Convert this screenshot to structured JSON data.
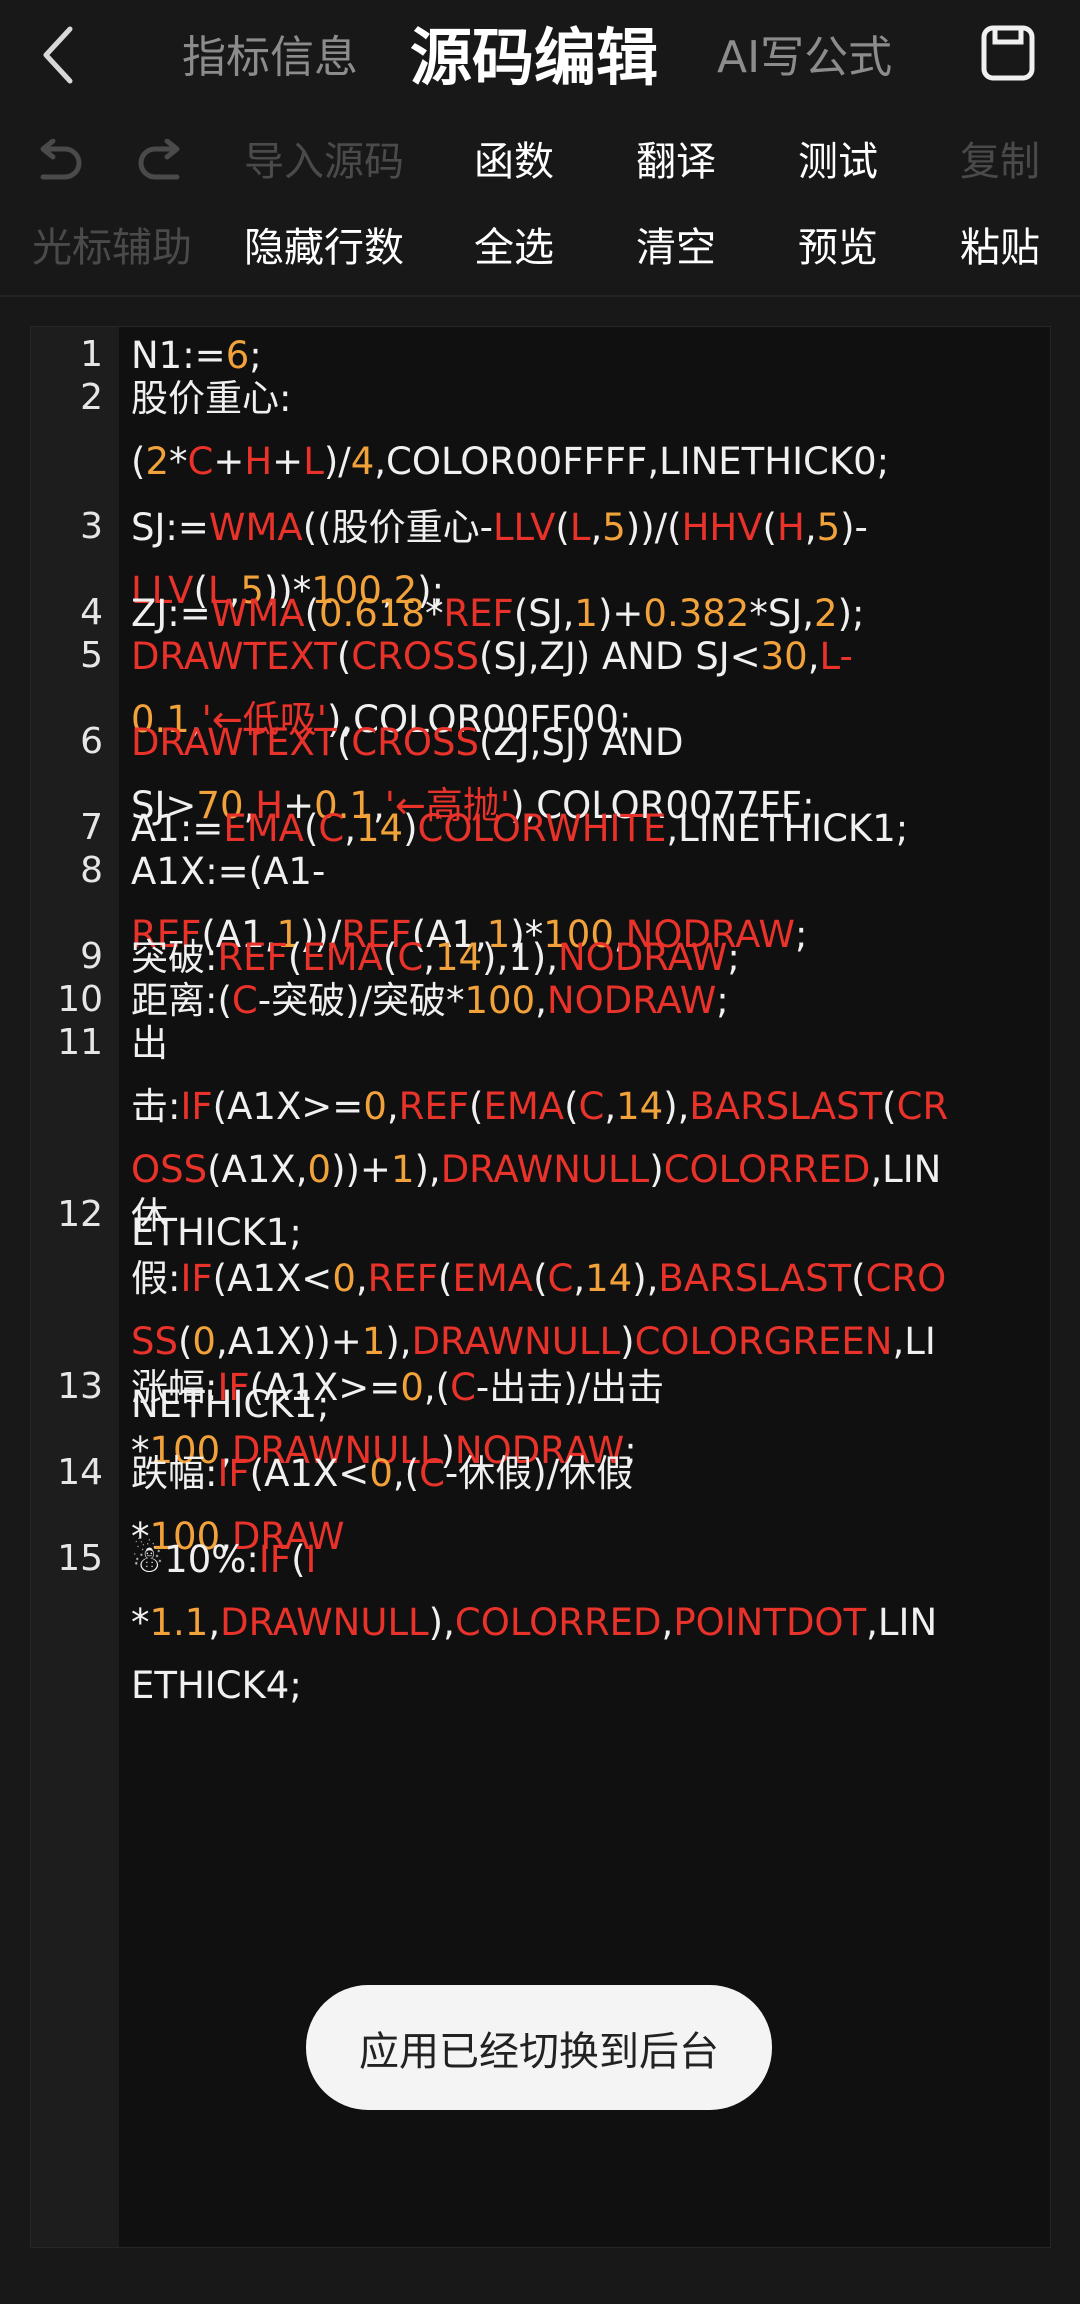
{
  "header": {
    "back_icon": "chevron-left-icon",
    "tab_info": "指标信息",
    "tab_edit": "源码编辑",
    "tab_ai": "AI写公式",
    "save_icon": "save-icon"
  },
  "toolbar": {
    "undo_icon": "undo-icon",
    "redo_icon": "redo-icon",
    "import": "导入源码",
    "functions": "函数",
    "translate": "翻译",
    "test": "测试",
    "copy": "复制",
    "cursor_assist": "光标辅助",
    "hide_line_numbers": "隐藏行数",
    "select_all": "全选",
    "clear": "清空",
    "preview": "预览",
    "paste": "粘贴"
  },
  "colors": {
    "background": "#181818",
    "editor_bg": "#101010",
    "gutter_bg": "#1d1d1d",
    "keyword_red": "#e8322a",
    "number_orange": "#f1a23a",
    "plain_text": "#f0f0f0",
    "disabled": "#4a4a4a"
  },
  "code_lines": [
    {
      "num": "1",
      "rows": [
        [
          [
            "N1:=",
            ""
          ],
          [
            "6",
            "o"
          ],
          [
            ";",
            ""
          ]
        ]
      ]
    },
    {
      "num": "2",
      "rows": [
        [
          [
            "股价重心:",
            ""
          ]
        ],
        [
          [
            "(",
            ""
          ],
          [
            "2",
            "o"
          ],
          [
            "*",
            ""
          ],
          [
            "C",
            "r"
          ],
          [
            "+",
            ""
          ],
          [
            "H",
            "r"
          ],
          [
            "+",
            ""
          ],
          [
            "L",
            "r"
          ],
          [
            ")/",
            ""
          ],
          [
            "4",
            "o"
          ],
          [
            ",COLOR00FFFF,LINETHICK0;",
            ""
          ]
        ]
      ]
    },
    {
      "num": "3",
      "rows": [
        [
          [
            "SJ:=",
            ""
          ],
          [
            "WMA",
            "r"
          ],
          [
            "((股价重心-",
            ""
          ],
          [
            "LLV",
            "r"
          ],
          [
            "(",
            ""
          ],
          [
            "L",
            "r"
          ],
          [
            ",",
            ""
          ],
          [
            "5",
            "o"
          ],
          [
            "))/(",
            ""
          ],
          [
            "HHV",
            "r"
          ],
          [
            "(",
            ""
          ],
          [
            "H",
            "r"
          ],
          [
            ",",
            ""
          ],
          [
            "5",
            "o"
          ],
          [
            ")-",
            ""
          ]
        ],
        [
          [
            "LLV",
            "r"
          ],
          [
            "(",
            ""
          ],
          [
            "L",
            "r"
          ],
          [
            ",",
            ""
          ],
          [
            "5",
            "o"
          ],
          [
            "))*",
            ""
          ],
          [
            "100",
            "o"
          ],
          [
            ",",
            ""
          ],
          [
            "2",
            "o"
          ],
          [
            ");",
            ""
          ]
        ]
      ]
    },
    {
      "num": "4",
      "rows": [
        [
          [
            "ZJ:=",
            ""
          ],
          [
            "WMA",
            "r"
          ],
          [
            "(",
            ""
          ],
          [
            "0.618",
            "o"
          ],
          [
            "*",
            ""
          ],
          [
            "REF",
            "r"
          ],
          [
            "(SJ,",
            ""
          ],
          [
            "1",
            "o"
          ],
          [
            ")+",
            ""
          ],
          [
            "0.382",
            "o"
          ],
          [
            "*SJ,",
            ""
          ],
          [
            "2",
            "o"
          ],
          [
            ");",
            ""
          ]
        ]
      ]
    },
    {
      "num": "5",
      "rows": [
        [
          [
            "DRAWTEXT",
            "r"
          ],
          [
            "(",
            ""
          ],
          [
            "CROSS",
            "r"
          ],
          [
            "(SJ,ZJ) AND SJ<",
            ""
          ],
          [
            "30",
            "o"
          ],
          [
            ",",
            ""
          ],
          [
            "L-",
            "r"
          ]
        ],
        [
          [
            "0.1",
            "o"
          ],
          [
            ",",
            ""
          ],
          [
            "'←低吸'",
            "r"
          ],
          [
            "),COLOR00FF00;",
            ""
          ]
        ]
      ]
    },
    {
      "num": "6",
      "rows": [
        [
          [
            "DRAWTEXT",
            "r"
          ],
          [
            "(",
            ""
          ],
          [
            "CROSS",
            "r"
          ],
          [
            "(ZJ,SJ) AND",
            ""
          ]
        ],
        [
          [
            "SJ>",
            ""
          ],
          [
            "70",
            "o"
          ],
          [
            ",",
            ""
          ],
          [
            "H",
            "r"
          ],
          [
            "+",
            ""
          ],
          [
            "0.1",
            "o"
          ],
          [
            ",",
            ""
          ],
          [
            "'←高抛'",
            "r"
          ],
          [
            "),COLOR0077FF;",
            ""
          ]
        ]
      ]
    },
    {
      "num": "7",
      "rows": [
        [
          [
            "A1:=",
            ""
          ],
          [
            "EMA",
            "r"
          ],
          [
            "(",
            ""
          ],
          [
            "C",
            "r"
          ],
          [
            ",",
            ""
          ],
          [
            "14",
            "o"
          ],
          [
            ")",
            ""
          ],
          [
            "COLORWHITE",
            "r"
          ],
          [
            ",LINETHICK1;",
            ""
          ]
        ]
      ]
    },
    {
      "num": "8",
      "rows": [
        [
          [
            "A1X:=(A1-",
            ""
          ]
        ],
        [
          [
            "REF",
            "r"
          ],
          [
            "(A1,",
            ""
          ],
          [
            "1",
            "o"
          ],
          [
            "))/",
            ""
          ],
          [
            "REF",
            "r"
          ],
          [
            "(A1,",
            ""
          ],
          [
            "1",
            "o"
          ],
          [
            ")*",
            ""
          ],
          [
            "100",
            "o"
          ],
          [
            ",",
            ""
          ],
          [
            "NODRAW",
            "r"
          ],
          [
            ";",
            ""
          ]
        ]
      ]
    },
    {
      "num": "9",
      "rows": [
        [
          [
            "突破:",
            ""
          ],
          [
            "REF",
            "r"
          ],
          [
            "(",
            ""
          ],
          [
            "EMA",
            "r"
          ],
          [
            "(",
            ""
          ],
          [
            "C",
            "r"
          ],
          [
            ",",
            ""
          ],
          [
            "14",
            "o"
          ],
          [
            "),1),",
            ""
          ],
          [
            "NODRAW",
            "r"
          ],
          [
            ";",
            ""
          ]
        ]
      ]
    },
    {
      "num": "10",
      "rows": [
        [
          [
            "距离:(",
            ""
          ],
          [
            "C",
            "r"
          ],
          [
            "-突破)/突破*",
            ""
          ],
          [
            "100",
            "o"
          ],
          [
            ",",
            ""
          ],
          [
            "NODRAW",
            "r"
          ],
          [
            ";",
            ""
          ]
        ]
      ]
    },
    {
      "num": "11",
      "rows": [
        [
          [
            "出",
            ""
          ]
        ],
        [
          [
            "击:",
            ""
          ],
          [
            "IF",
            "r"
          ],
          [
            "(A1X>=",
            ""
          ],
          [
            "0",
            "o"
          ],
          [
            ",",
            ""
          ],
          [
            "REF",
            "r"
          ],
          [
            "(",
            ""
          ],
          [
            "EMA",
            "r"
          ],
          [
            "(",
            ""
          ],
          [
            "C",
            "r"
          ],
          [
            ",",
            ""
          ],
          [
            "14",
            "o"
          ],
          [
            "),",
            ""
          ],
          [
            "BARSLAST",
            "r"
          ],
          [
            "(",
            ""
          ],
          [
            "CR",
            "r"
          ]
        ],
        [
          [
            "OSS",
            "r"
          ],
          [
            "(A1X,",
            ""
          ],
          [
            "0",
            "o"
          ],
          [
            "))+",
            ""
          ],
          [
            "1",
            "o"
          ],
          [
            "),",
            ""
          ],
          [
            "DRAWNULL",
            "r"
          ],
          [
            ")",
            ""
          ],
          [
            "COLORRED",
            "r"
          ],
          [
            ",LIN",
            ""
          ]
        ],
        [
          [
            "ETHICK1;",
            ""
          ]
        ]
      ]
    },
    {
      "num": "12",
      "rows": [
        [
          [
            "休",
            ""
          ]
        ],
        [
          [
            "假:",
            ""
          ],
          [
            "IF",
            "r"
          ],
          [
            "(A1X<",
            ""
          ],
          [
            "0",
            "o"
          ],
          [
            ",",
            ""
          ],
          [
            "REF",
            "r"
          ],
          [
            "(",
            ""
          ],
          [
            "EMA",
            "r"
          ],
          [
            "(",
            ""
          ],
          [
            "C",
            "r"
          ],
          [
            ",",
            ""
          ],
          [
            "14",
            "o"
          ],
          [
            "),",
            ""
          ],
          [
            "BARSLAST",
            "r"
          ],
          [
            "(",
            ""
          ],
          [
            "CRO",
            "r"
          ]
        ],
        [
          [
            "SS",
            "r"
          ],
          [
            "(",
            ""
          ],
          [
            "0",
            "o"
          ],
          [
            ",A1X))+",
            ""
          ],
          [
            "1",
            "o"
          ],
          [
            "),",
            ""
          ],
          [
            "DRAWNULL",
            "r"
          ],
          [
            ")",
            ""
          ],
          [
            "COLORGREEN",
            "r"
          ],
          [
            ",LI",
            ""
          ]
        ],
        [
          [
            "NETHICK1;",
            ""
          ]
        ]
      ]
    },
    {
      "num": "13",
      "rows": [
        [
          [
            "涨幅:",
            ""
          ],
          [
            "IF",
            "r"
          ],
          [
            "(A1X>=",
            ""
          ],
          [
            "0",
            "o"
          ],
          [
            ",(",
            ""
          ],
          [
            "C",
            "r"
          ],
          [
            "-出击)/出击",
            ""
          ]
        ],
        [
          [
            "*",
            ""
          ],
          [
            "100",
            "o"
          ],
          [
            ",",
            ""
          ],
          [
            "DRAWNULL",
            "r"
          ],
          [
            ")",
            ""
          ],
          [
            "NODRAW",
            "r"
          ],
          [
            ";",
            ""
          ]
        ]
      ]
    },
    {
      "num": "14",
      "rows": [
        [
          [
            "跌幅:",
            ""
          ],
          [
            "IF",
            "r"
          ],
          [
            "(A1X<",
            ""
          ],
          [
            "0",
            "o"
          ],
          [
            ",(",
            ""
          ],
          [
            "C",
            "r"
          ],
          [
            "-休假)/休假",
            ""
          ]
        ],
        [
          [
            "*",
            ""
          ],
          [
            "100",
            "o"
          ],
          [
            ",",
            ""
          ],
          [
            "DRAW",
            "r"
          ]
        ]
      ]
    },
    {
      "num": "15",
      "rows": [
        [
          [
            "☃10%:",
            ""
          ],
          [
            "IF",
            "r"
          ],
          [
            "(",
            ""
          ],
          [
            "I",
            "r"
          ]
        ],
        [
          [
            "*",
            ""
          ],
          [
            "1.1",
            "o"
          ],
          [
            ",",
            ""
          ],
          [
            "DRAWNULL",
            "r"
          ],
          [
            "),",
            ""
          ],
          [
            "COLORRED",
            "r"
          ],
          [
            ",",
            ""
          ],
          [
            "POINTDOT",
            "r"
          ],
          [
            ",LIN",
            ""
          ]
        ],
        [
          [
            "ETHICK4;",
            ""
          ]
        ]
      ]
    }
  ],
  "toast": {
    "message": "应用已经切换到后台"
  }
}
